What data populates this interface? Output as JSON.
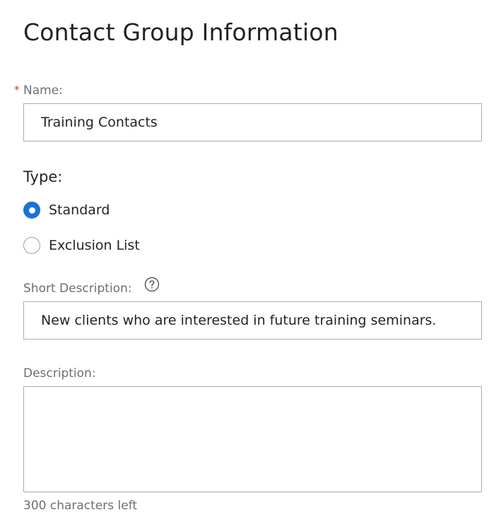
{
  "form": {
    "title": "Contact Group Information",
    "name": {
      "required_marker": "*",
      "label": "Name:",
      "value": "Training Contacts"
    },
    "type": {
      "label": "Type:",
      "options": [
        {
          "label": "Standard",
          "checked": true
        },
        {
          "label": "Exclusion List",
          "checked": false
        }
      ]
    },
    "short_description": {
      "label": "Short Description:",
      "help_icon": "question-circle-icon",
      "value": "New clients who are interested in future training seminars."
    },
    "description": {
      "label": "Description:",
      "value": "",
      "char_count_text": "300 characters left"
    }
  },
  "colors": {
    "accent": "#1a73d9",
    "required": "#d4351c",
    "label": "#6b7075",
    "border": "#a8adb3",
    "text": "#1f2327"
  }
}
